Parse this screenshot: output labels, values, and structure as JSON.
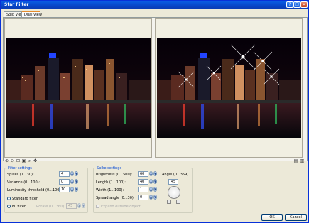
{
  "window": {
    "title": "Star Filter"
  },
  "tabs": [
    {
      "label": "Split View"
    },
    {
      "label": "Dual View"
    }
  ],
  "filter_settings": {
    "caption": "Filter settings",
    "spikes": {
      "label": "Spikes (1...30):",
      "value": "4"
    },
    "variance": {
      "label": "Variance (0...100):",
      "value": "0"
    },
    "luminosity": {
      "label": "Luminosity threshold (0...100):",
      "value": "10"
    },
    "standard_filter": {
      "label": "Standard filter"
    },
    "pl_filter": {
      "label": "PL filter"
    },
    "rotate": {
      "label": "Rotate (0...360):",
      "value": "45"
    }
  },
  "spike_settings": {
    "caption": "Spike settings",
    "brightness": {
      "label": "Brightness (0...500):",
      "value": "60"
    },
    "length": {
      "label": "Length (1...100):",
      "value": "40"
    },
    "width": {
      "label": "Width (1...100):",
      "value": "1"
    },
    "spread": {
      "label": "Spread angle (0...30):",
      "value": "0"
    },
    "expand": {
      "label": "Expand outside object"
    },
    "angle": {
      "label": "Angle (0...359)",
      "value": "45"
    }
  },
  "buttons": {
    "ok": "OK",
    "cancel": "Cancel"
  }
}
